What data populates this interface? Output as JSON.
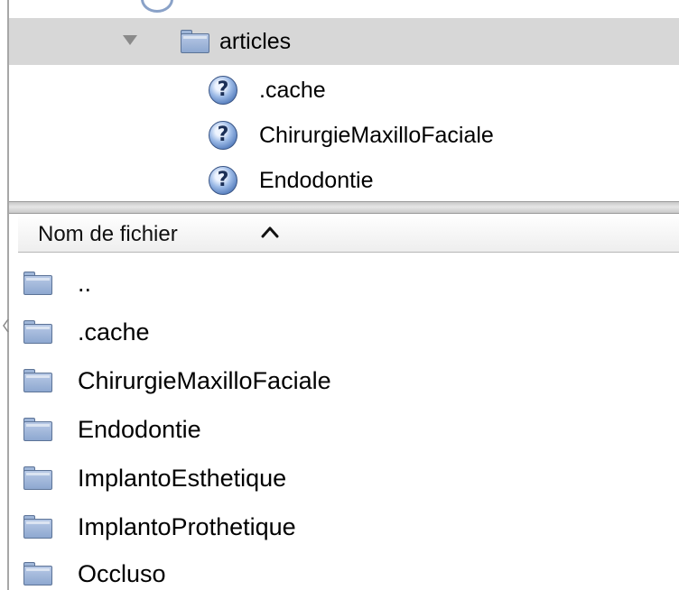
{
  "tree": {
    "selected_item": {
      "label": "articles",
      "expanded": true,
      "icon": "folder-icon"
    },
    "children": [
      {
        "label": ".cache",
        "icon": "help-icon"
      },
      {
        "label": "ChirurgieMaxilloFaciale",
        "icon": "help-icon"
      },
      {
        "label": "Endodontie",
        "icon": "help-icon"
      }
    ]
  },
  "file_list": {
    "column_header": "Nom de fichier",
    "sort_direction": "ascending",
    "items": [
      {
        "label": "..",
        "icon": "folder-icon"
      },
      {
        "label": ".cache",
        "icon": "folder-icon"
      },
      {
        "label": "ChirurgieMaxilloFaciale",
        "icon": "folder-icon"
      },
      {
        "label": "Endodontie",
        "icon": "folder-icon"
      },
      {
        "label": "ImplantoEsthetique",
        "icon": "folder-icon"
      },
      {
        "label": "ImplantoProthetique",
        "icon": "folder-icon"
      },
      {
        "label": "Occluso",
        "icon": "folder-icon"
      }
    ]
  },
  "colors": {
    "selection_background": "#d7d7d7",
    "folder_fill": "#8ea8d0",
    "folder_outline": "#5c7397",
    "help_icon": "#5b82c0"
  }
}
